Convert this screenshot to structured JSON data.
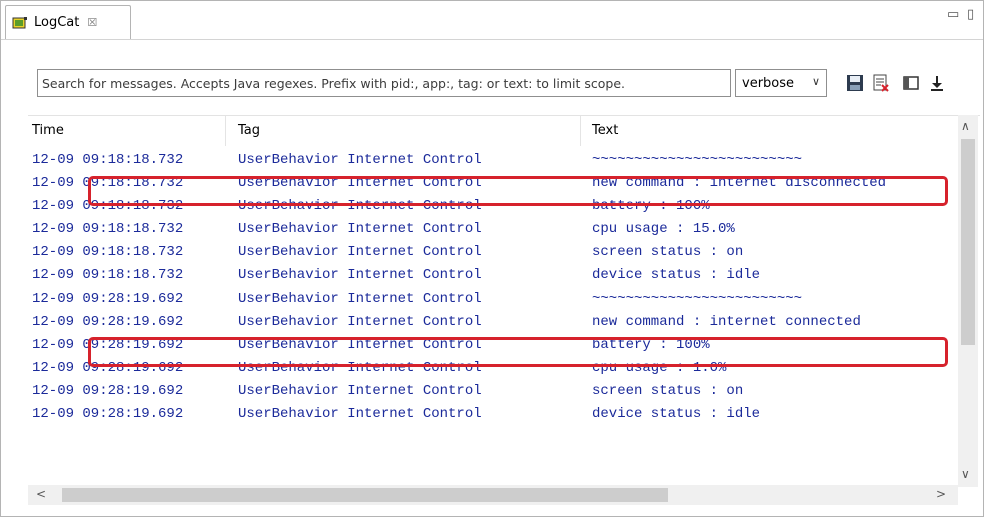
{
  "tab": {
    "label": "LogCat",
    "close": "☒"
  },
  "view_controls": {
    "minimize": "▭",
    "maximize": "▯"
  },
  "search": {
    "placeholder": "Search for messages. Accepts Java regexes. Prefix with pid:, app:, tag: or text: to limit scope."
  },
  "level": {
    "selected": "verbose",
    "chevron": "∨"
  },
  "table": {
    "headers": {
      "time": "Time",
      "tag": "Tag",
      "text": "Text"
    },
    "rows": [
      {
        "time": "12-09 09:18:18.732",
        "tag": "UserBehavior Internet Control",
        "text": "~~~~~~~~~~~~~~~~~~~~~~~~~"
      },
      {
        "time": "12-09 09:18:18.732",
        "tag": "UserBehavior Internet Control",
        "text": "new command : internet disconnected"
      },
      {
        "time": "12-09 09:18:18.732",
        "tag": "UserBehavior Internet Control",
        "text": "battery : 100%"
      },
      {
        "time": "12-09 09:18:18.732",
        "tag": "UserBehavior Internet Control",
        "text": "cpu usage : 15.0%"
      },
      {
        "time": "12-09 09:18:18.732",
        "tag": "UserBehavior Internet Control",
        "text": "screen status : on"
      },
      {
        "time": "12-09 09:18:18.732",
        "tag": "UserBehavior Internet Control",
        "text": "device status : idle"
      },
      {
        "time": "12-09 09:28:19.692",
        "tag": "UserBehavior Internet Control",
        "text": "~~~~~~~~~~~~~~~~~~~~~~~~~"
      },
      {
        "time": "12-09 09:28:19.692",
        "tag": "UserBehavior Internet Control",
        "text": "new command : internet connected"
      },
      {
        "time": "12-09 09:28:19.692",
        "tag": "UserBehavior Internet Control",
        "text": "battery : 100%"
      },
      {
        "time": "12-09 09:28:19.692",
        "tag": "UserBehavior Internet Control",
        "text": "cpu usage : 1.0%"
      },
      {
        "time": "12-09 09:28:19.692",
        "tag": "UserBehavior Internet Control",
        "text": "screen status : on"
      },
      {
        "time": "12-09 09:28:19.692",
        "tag": "UserBehavior Internet Control",
        "text": "device status : idle"
      }
    ]
  },
  "scroll": {
    "up": "∧",
    "down": "∨",
    "left": "<",
    "right": ">"
  },
  "colors": {
    "log_text": "#1b2a9a",
    "highlight": "#d6222c"
  }
}
